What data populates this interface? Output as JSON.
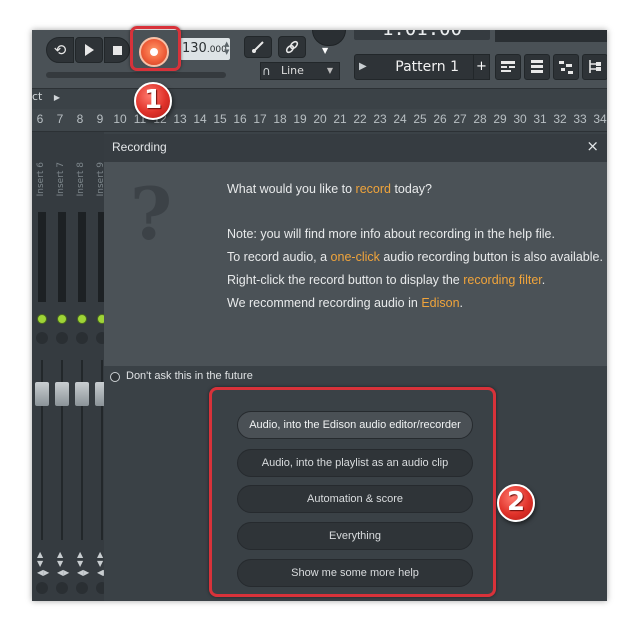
{
  "toolbar": {
    "tempo_main": "130",
    "tempo_fraction": ".000",
    "time_display": "1:01:00",
    "line_mode": "Line",
    "pattern_name": "Pattern 1",
    "pattern_add": "+"
  },
  "breadcrumb": "ct",
  "ruler_ticks": [
    "6",
    "7",
    "8",
    "9",
    "10",
    "11",
    "12",
    "13",
    "14",
    "15",
    "16",
    "17",
    "18",
    "19",
    "20",
    "21",
    "22",
    "23",
    "24",
    "25",
    "26",
    "27",
    "28",
    "29",
    "30",
    "31",
    "32",
    "33",
    "34"
  ],
  "mixer_strips": [
    "Insert 6",
    "Insert 7",
    "Insert 8",
    "Insert 9"
  ],
  "dialog": {
    "title": "Recording",
    "close": "×",
    "question_mark": "?",
    "line1_pre": "What would you like to ",
    "line1_link": "record",
    "line1_post": " today?",
    "line2": "Note: you will find more info about recording in the help file.",
    "line3_pre": "To record audio, a ",
    "line3_link": "one-click",
    "line3_post": " audio recording button is also available.",
    "line4_pre": "Right-click the record button to display the ",
    "line4_link": "recording filter",
    "line4_post": ".",
    "line5_pre": "We recommend recording audio in ",
    "line5_link": "Edison",
    "line5_post": ".",
    "dont_ask": "Don't ask this in the future",
    "options": [
      "Audio, into the Edison audio editor/recorder",
      "Audio, into the playlist as an audio clip",
      "Automation & score",
      "Everything",
      "Show me some more help"
    ]
  },
  "annotations": {
    "badge_1": "1",
    "badge_2": "2"
  },
  "colors": {
    "highlight_orange": "#f0a43b",
    "annotation_red": "#d8323a",
    "record_button": "#f05f3a"
  }
}
